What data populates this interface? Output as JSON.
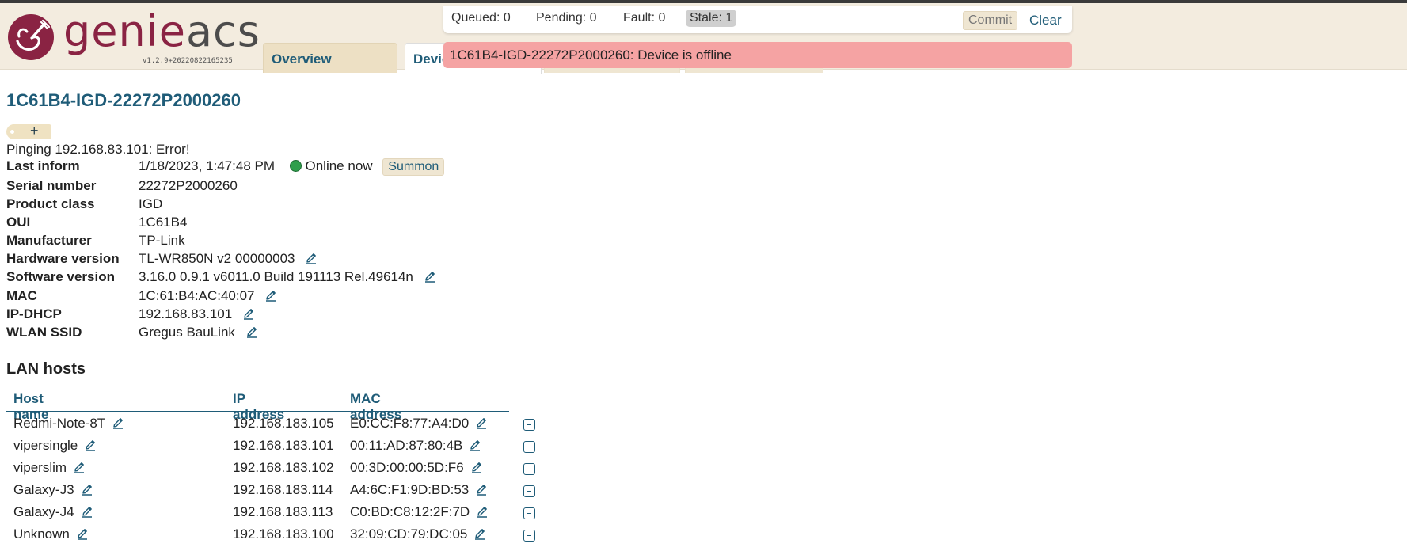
{
  "app": {
    "logo": {
      "part1": "genie",
      "part2": "acs"
    },
    "version": "v1.2.9+20220822165235"
  },
  "nav": {
    "tabs": [
      {
        "label": "Overview"
      },
      {
        "label": "Devices"
      }
    ]
  },
  "queue": {
    "queued": "Queued: 0",
    "pending": "Pending: 0",
    "fault": "Fault: 0",
    "stale": "Stale: 1",
    "commit_label": "Commit",
    "clear_label": "Clear"
  },
  "notification": {
    "message": "1C61B4-IGD-22272P2000260: Device is offline",
    "color": "#f5a3a3"
  },
  "device": {
    "title": "1C61B4-IGD-22272P2000260",
    "tag_add": "+",
    "ping": "Pinging 192.168.83.101: Error!",
    "fields": [
      {
        "label": "Last inform",
        "value": "1/18/2023, 1:47:48 PM"
      },
      {
        "label": "Serial number",
        "value": "22272P2000260"
      },
      {
        "label": "Product class",
        "value": "IGD"
      },
      {
        "label": "OUI",
        "value": "1C61B4"
      },
      {
        "label": "Manufacturer",
        "value": "TP-Link"
      },
      {
        "label": "Hardware version",
        "value": "TL-WR850N v2 00000003"
      },
      {
        "label": "Software version",
        "value": "3.16.0 0.9.1 v6011.0 Build 191113 Rel.49614n"
      },
      {
        "label": "MAC",
        "value": "1C:61:B4:AC:40:07"
      },
      {
        "label": "IP-DHCP",
        "value": "192.168.83.101"
      },
      {
        "label": "WLAN SSID",
        "value": "Gregus BauLink"
      }
    ],
    "online_status": "Online now",
    "summon_label": "Summon"
  },
  "lan_hosts": {
    "title": "LAN hosts",
    "columns": [
      "Host name",
      "IP address",
      "MAC address"
    ],
    "rows": [
      {
        "host": "Redmi-Note-8T",
        "ip": "192.168.183.105",
        "mac": "E0:CC:F8:77:A4:D0"
      },
      {
        "host": "vipersingle",
        "ip": "192.168.183.101",
        "mac": "00:11:AD:87:80:4B"
      },
      {
        "host": "viperslim",
        "ip": "192.168.183.102",
        "mac": "00:3D:00:00:5D:F6"
      },
      {
        "host": "Galaxy-J3",
        "ip": "192.168.183.114",
        "mac": "A4:6C:F1:9D:BD:53"
      },
      {
        "host": "Galaxy-J4",
        "ip": "192.168.183.113",
        "mac": "C0:BD:C8:12:2F:7D"
      },
      {
        "host": "Unknown",
        "ip": "192.168.183.100",
        "mac": "32:09:CD:79:DC:05"
      }
    ]
  },
  "icons": {
    "edit": "pencil-icon",
    "delete": "minus-square-icon",
    "status": "online-dot-icon"
  },
  "colors": {
    "brand": "#8a2343",
    "link": "#1f5c78",
    "header_bg": "#f3ecdf",
    "online": "#2f9e4b"
  }
}
